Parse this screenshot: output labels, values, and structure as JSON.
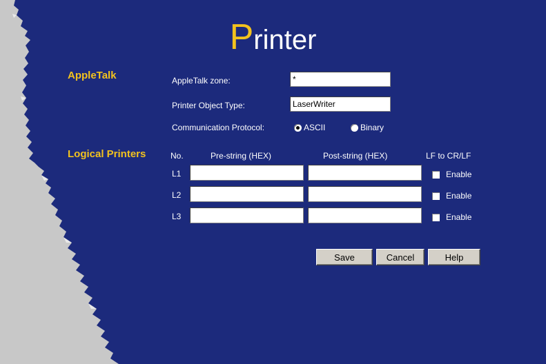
{
  "title": {
    "first_letter": "P",
    "rest": "rinter"
  },
  "appletalk": {
    "section_label": "AppleTalk",
    "zone_label": "AppleTalk zone:",
    "zone_value": "*",
    "object_type_label": "Printer Object Type:",
    "object_type_value": "LaserWriter",
    "protocol_label": "Communication Protocol:",
    "protocol_options": [
      "ASCII",
      "Binary"
    ],
    "protocol_selected": "ASCII"
  },
  "logical_printers": {
    "section_label": "Logical Printers",
    "columns": {
      "no": "No.",
      "pre": "Pre-string (HEX)",
      "post": "Post-string (HEX)",
      "lf": "LF to CR/LF"
    },
    "rows": [
      {
        "label": "L1",
        "pre": "",
        "post": "",
        "enable_label": "Enable",
        "checked": false
      },
      {
        "label": "L2",
        "pre": "",
        "post": "",
        "enable_label": "Enable",
        "checked": false
      },
      {
        "label": "L3",
        "pre": "",
        "post": "",
        "enable_label": "Enable",
        "checked": false
      }
    ]
  },
  "buttons": {
    "save": "Save",
    "cancel": "Cancel",
    "help": "Help"
  },
  "colors": {
    "background": "#1c2a7c",
    "accent": "#f2c21e",
    "paper": "#c8c8c8"
  }
}
